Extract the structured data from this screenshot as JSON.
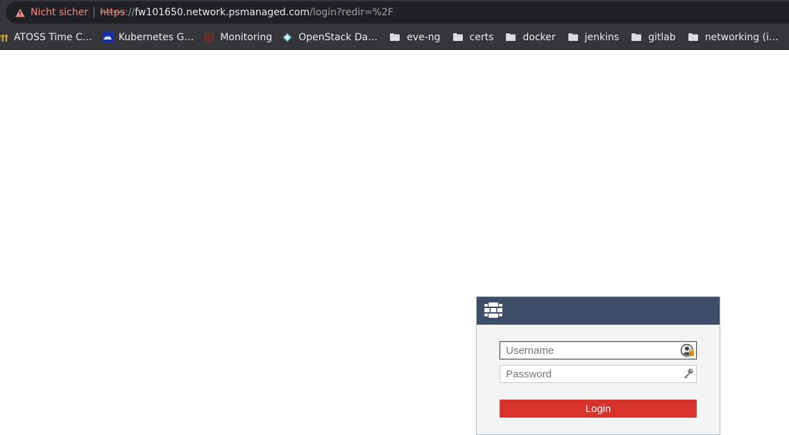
{
  "browser": {
    "security_label": "Nicht sicher",
    "url": {
      "scheme": "https",
      "separator": "://",
      "host": "fw101650.network.psmanaged.com",
      "path": "/login?redir=%2F"
    },
    "bookmarks": [
      {
        "label": "ATOSS Time C…",
        "icon": "atoss-icon"
      },
      {
        "label": "Kubernetes G…",
        "icon": "kubernetes-icon"
      },
      {
        "label": "Monitoring",
        "icon": "monitoring-icon"
      },
      {
        "label": "OpenStack Da…",
        "icon": "openstack-icon"
      },
      {
        "label": "eve-ng",
        "icon": "folder-icon"
      },
      {
        "label": "certs",
        "icon": "folder-icon"
      },
      {
        "label": "docker",
        "icon": "folder-icon"
      },
      {
        "label": "jenkins",
        "icon": "folder-icon"
      },
      {
        "label": "gitlab",
        "icon": "folder-icon"
      },
      {
        "label": "networking (i…",
        "icon": "folder-icon"
      }
    ]
  },
  "login": {
    "username_placeholder": "Username",
    "password_placeholder": "Password",
    "login_label": "Login"
  },
  "colors": {
    "header": "#3f4e68",
    "login_button": "#d7322b",
    "not_secure": "#f28b82"
  }
}
